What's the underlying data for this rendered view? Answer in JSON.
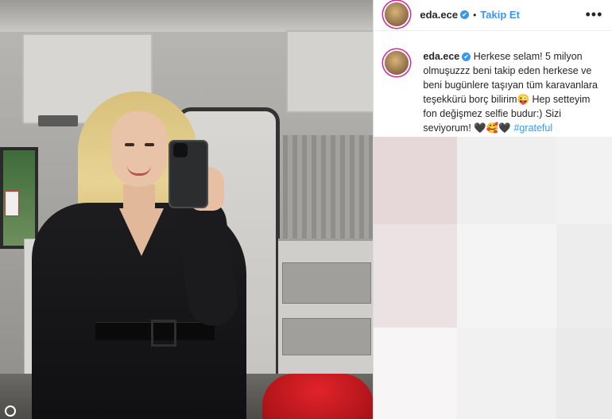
{
  "post": {
    "username": "eda.ece",
    "verified_mark": "✔",
    "separator": "•",
    "follow_label": "Takip Et",
    "more_label": "•••",
    "caption_username": "eda.ece",
    "caption_text": "Herkese selam! 5 milyon olmuşuzzz beni takip eden herkese ve beni bugünlere taşıyan tüm karavanlara teşekkürü borç bilirim😜 Hep setteyim fon değişmez selfie budur:) Sizi seviyorum! 🖤🥰🖤 ",
    "caption_hashtag": "#grateful"
  },
  "icons": {
    "verified": "verified-badge-icon",
    "more": "more-options-icon",
    "tag": "user-tag-icon"
  },
  "colors": {
    "link_blue": "#3897f0",
    "text": "#262626",
    "border": "#dbdbdb"
  }
}
